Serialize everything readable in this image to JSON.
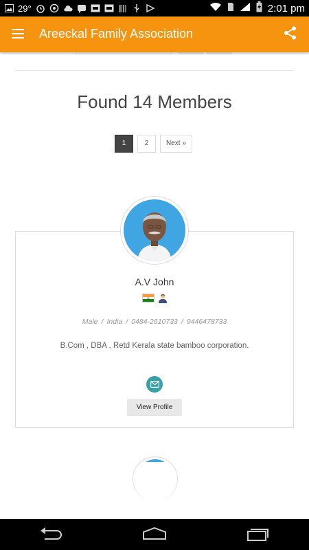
{
  "status_bar": {
    "temperature": "29°",
    "time": "2:01 pm",
    "left_icons": [
      "image-icon",
      "alarm-icon",
      "whatsapp-icon",
      "cloud-icon",
      "chat-icon",
      "gs-icon",
      "gs-icon",
      "barcode-icon",
      "usb-icon",
      "delivery-icon"
    ],
    "right_icons": [
      "wifi-icon",
      "signal-icon",
      "battery-icon"
    ]
  },
  "app_bar": {
    "title": "Areeckal Family Association",
    "color": "#f7940f"
  },
  "results": {
    "title": "Found 14 Members"
  },
  "pagination": {
    "pages": [
      "1",
      "2"
    ],
    "current": "1",
    "next_label": "Next »"
  },
  "member": {
    "name": "A.V John",
    "gender": "Male",
    "country": "India",
    "phone": "0484-2610733",
    "mobile": "9446478733",
    "bio": "B.Com , DBA , Retd Kerala state bamboo corporation.",
    "view_profile_label": "View Profile",
    "badges": [
      "india-flag-icon",
      "businessman-icon"
    ]
  },
  "colors": {
    "accent": "#f7940f",
    "mail_button": "#3aa0a8",
    "active_page": "#444444"
  }
}
